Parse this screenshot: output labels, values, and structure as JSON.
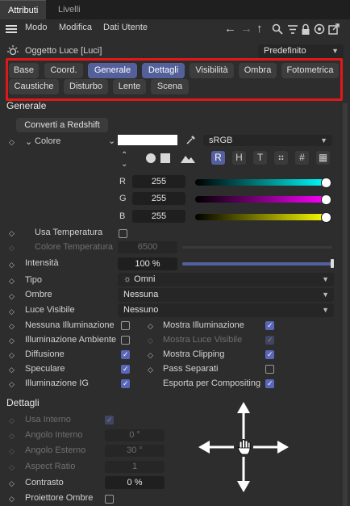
{
  "tabs": [
    "Attributi",
    "Livelli"
  ],
  "menu": [
    "Modo",
    "Modifica",
    "Dati Utente"
  ],
  "object": {
    "title": "Oggetto Luce [Luci]",
    "preset": "Predefinito"
  },
  "categories": [
    {
      "label": "Base",
      "selected": false
    },
    {
      "label": "Coord.",
      "selected": false
    },
    {
      "label": "Generale",
      "selected": true
    },
    {
      "label": "Dettagli",
      "selected": true
    },
    {
      "label": "Visibilità",
      "selected": false
    },
    {
      "label": "Ombra",
      "selected": false
    },
    {
      "label": "Fotometrica",
      "selected": false
    },
    {
      "label": "Caustiche",
      "selected": false
    },
    {
      "label": "Disturbo",
      "selected": false
    },
    {
      "label": "Lente",
      "selected": false
    },
    {
      "label": "Scena",
      "selected": false
    }
  ],
  "generale": {
    "heading": "Generale",
    "convert_button": "Converti a Redshift",
    "color_label": "Colore",
    "color_space": "sRGB",
    "mode_buttons": [
      "R",
      "H",
      "T"
    ],
    "rgb": [
      {
        "channel": "R",
        "value": "255"
      },
      {
        "channel": "G",
        "value": "255"
      },
      {
        "channel": "B",
        "value": "255"
      }
    ],
    "use_temperature": "Usa Temperatura",
    "color_temperature": "Colore Temperatura",
    "color_temperature_value": "6500",
    "intensity_label": "Intensità",
    "intensity_value": "100 %",
    "type_label": "Tipo",
    "type_value": "Omni",
    "shadows_label": "Ombre",
    "shadows_value": "Nessuna",
    "visible_light_label": "Luce Visibile",
    "visible_light_value": "Nessuno",
    "checks_left": [
      {
        "label": "Nessuna Illuminazione",
        "checked": false
      },
      {
        "label": "Illuminazione Ambiente",
        "checked": false
      },
      {
        "label": "Diffusione",
        "checked": true
      },
      {
        "label": "Speculare",
        "checked": true
      },
      {
        "label": "Illuminazione IG",
        "checked": true
      }
    ],
    "checks_right": [
      {
        "label": "Mostra Illuminazione",
        "checked": true,
        "dim": false
      },
      {
        "label": "Mostra Luce Visibile",
        "checked": true,
        "dim": true
      },
      {
        "label": "Mostra Clipping",
        "checked": true,
        "dim": false
      },
      {
        "label": "Pass Separati",
        "checked": false,
        "dim": false
      },
      {
        "label": "Esporta per Compositing",
        "checked": true,
        "dim": false
      }
    ]
  },
  "dettagli": {
    "heading": "Dettagli",
    "use_inner": "Usa Interno",
    "inner_angle": "Angolo Interno",
    "inner_angle_value": "0 °",
    "outer_angle": "Angolo Esterno",
    "outer_angle_value": "30 °",
    "aspect_ratio": "Aspect Ratio",
    "aspect_ratio_value": "1",
    "contrast": "Contrasto",
    "contrast_value": "0 %",
    "projector_shadow": "Proiettore Ombre"
  }
}
